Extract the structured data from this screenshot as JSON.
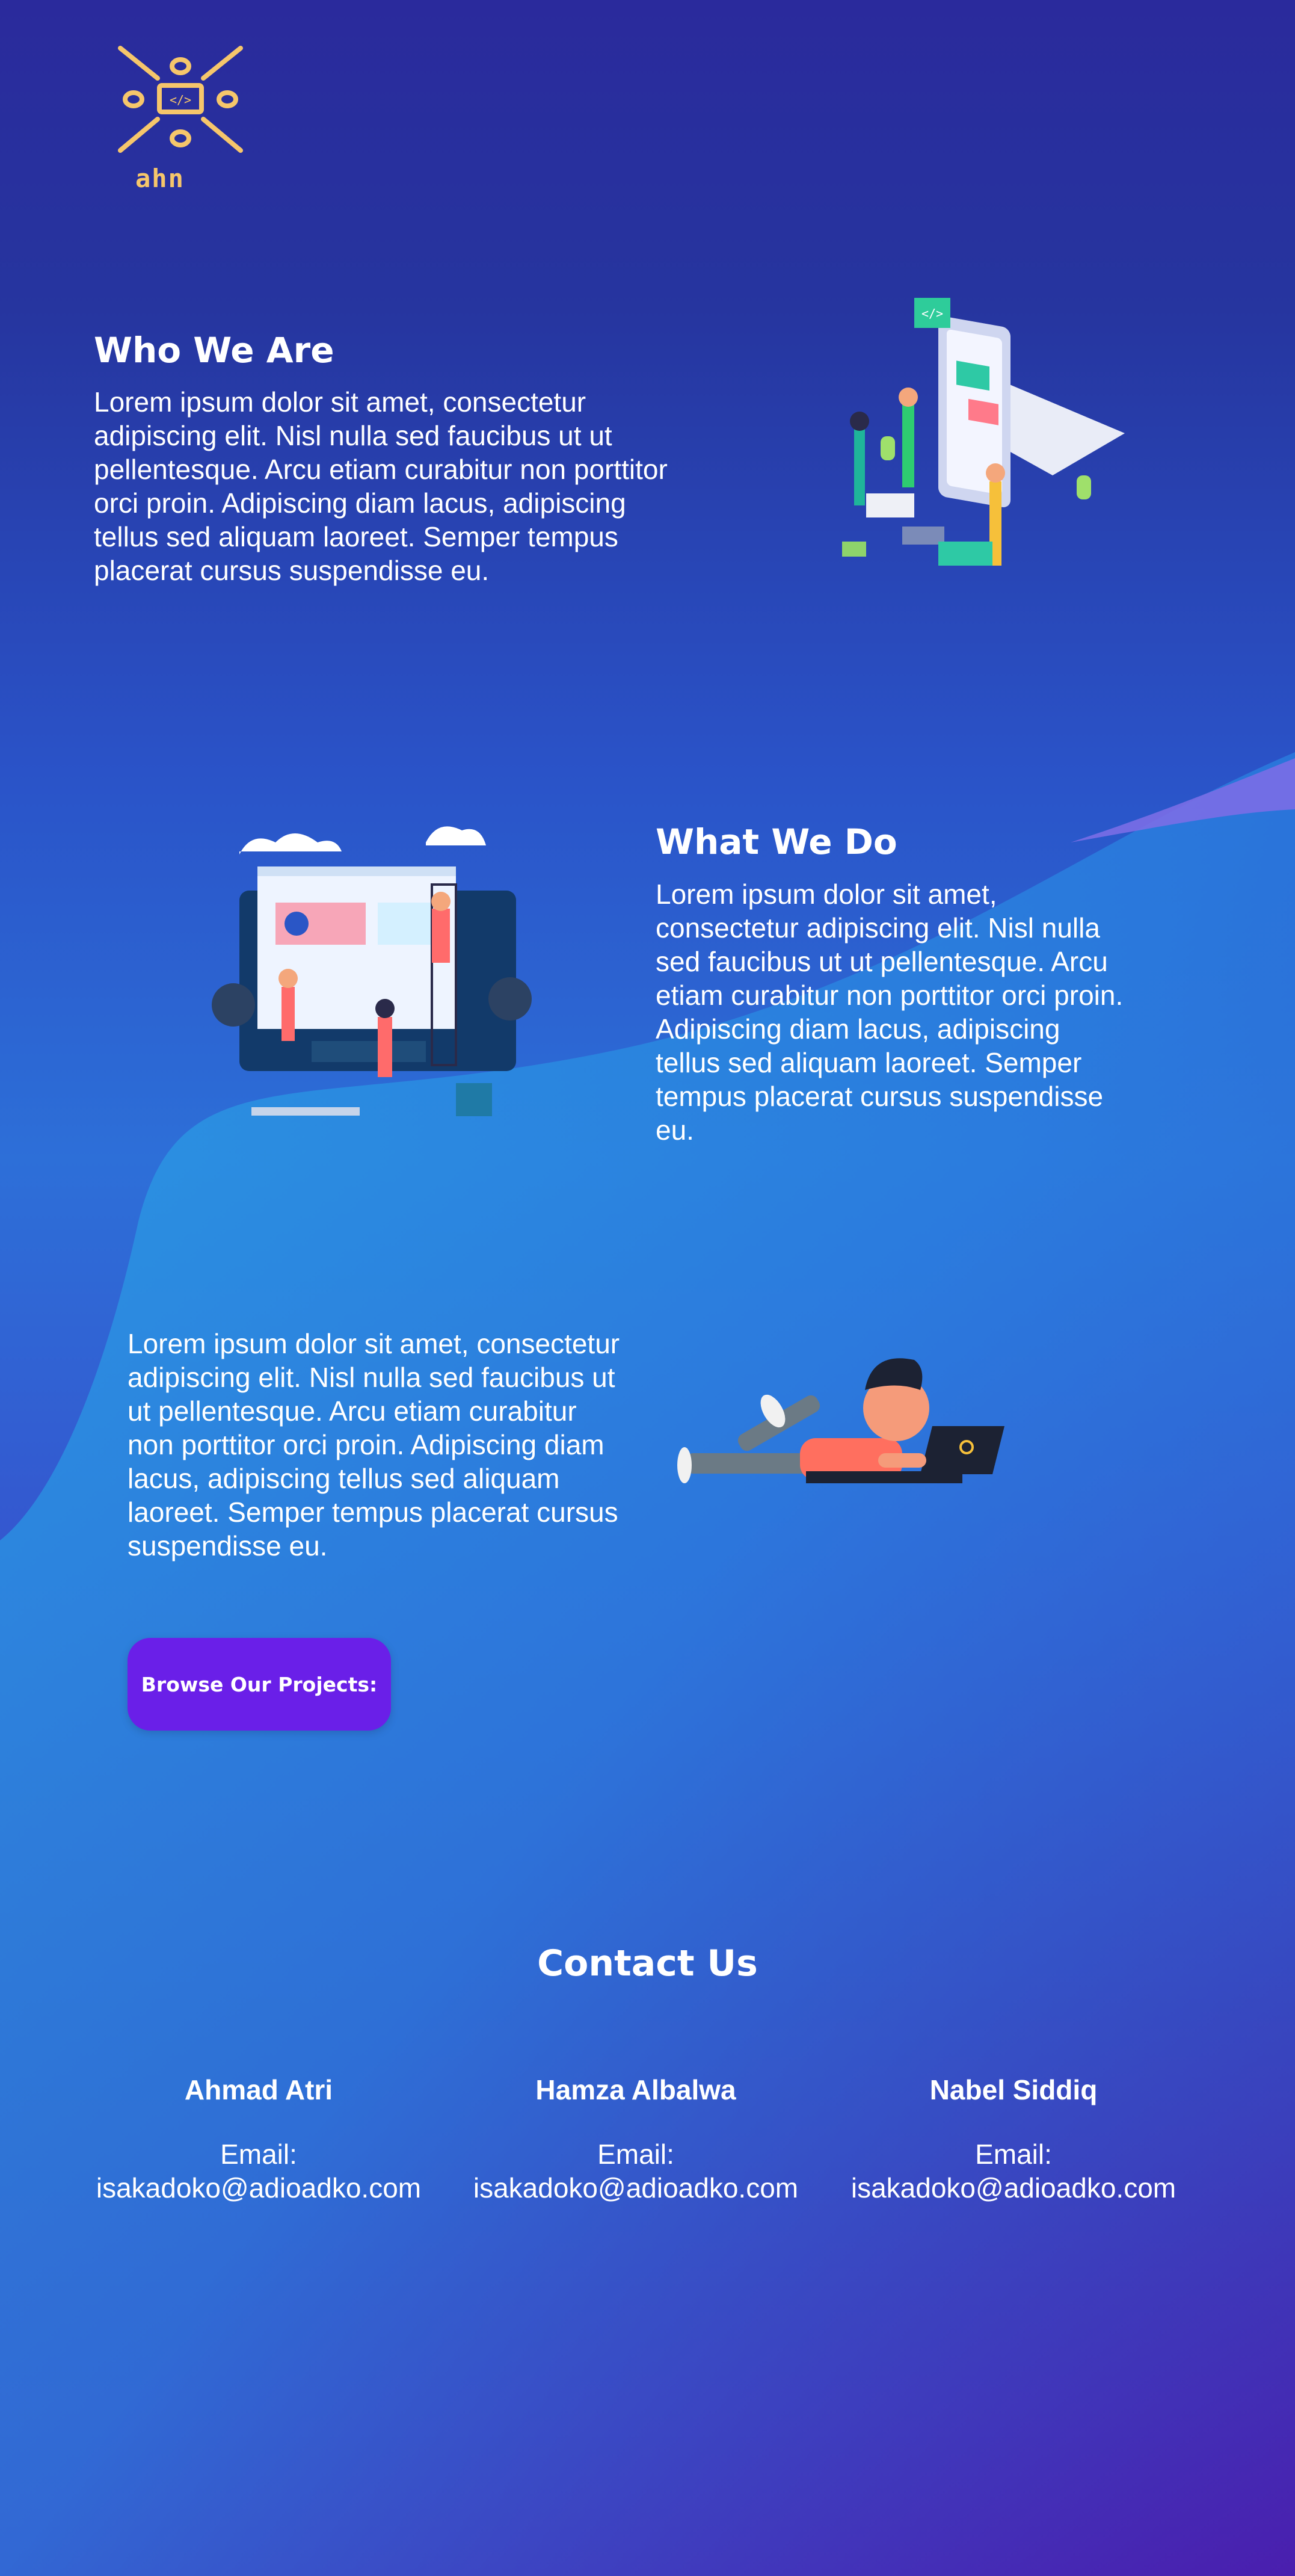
{
  "brand": {
    "logo_text": "ahn"
  },
  "sections": [
    {
      "title": "Who We Are",
      "text": "Lorem ipsum dolor sit amet, consectetur adipiscing elit. Nisl nulla sed faucibus ut ut pellentesque. Arcu etiam curabitur non porttitor orci proin. Adipiscing diam lacus, adipiscing tellus sed aliquam laoreet. Semper tempus placerat cursus suspendisse eu."
    },
    {
      "title": "What We Do",
      "text": "Lorem ipsum dolor sit amet, consectetur adipiscing elit. Nisl nulla sed faucibus ut ut pellentesque. Arcu etiam curabitur non porttitor orci proin. Adipiscing diam lacus, adipiscing tellus sed aliquam laoreet. Semper tempus placerat cursus suspendisse eu."
    },
    {
      "text": "Lorem ipsum dolor sit amet, consectetur adipiscing elit. Nisl nulla sed faucibus ut ut pellentesque. Arcu etiam curabitur non porttitor orci proin. Adipiscing diam lacus, adipiscing tellus sed aliquam laoreet. Semper tempus placerat cursus suspendisse eu."
    }
  ],
  "cta": {
    "label": "Browse Our Projects:"
  },
  "contact": {
    "title": "Contact Us",
    "people": [
      {
        "name": "Ahmad Atri",
        "email_label": "Email:",
        "email": "isakadoko@adioadko.com"
      },
      {
        "name": "Hamza Albalwa",
        "email_label": "Email:",
        "email": "isakadoko@adioadko.com"
      },
      {
        "name": "Nabel Siddiq",
        "email_label": "Email:",
        "email": "isakadoko@adioadko.com"
      }
    ]
  },
  "colors": {
    "accent": "#6a1fe8",
    "logo": "#f6c66b",
    "wave_light": "#2d8ee6",
    "wave_purple": "#7a6ee6"
  },
  "illustrations": [
    "mobile-app-illustration",
    "website-building-illustration",
    "person-laptop-illustration"
  ]
}
